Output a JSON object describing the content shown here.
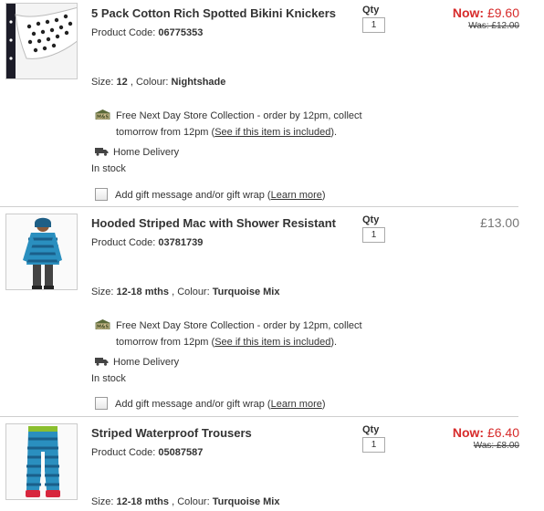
{
  "items": [
    {
      "title": "5 Pack Cotton Rich Spotted Bikini Knickers",
      "code_label": "Product Code:",
      "code": "06775353",
      "qty_label": "Qty",
      "qty": "1",
      "price_now_label": "Now:",
      "price_now": "£9.60",
      "price_was": "Was: £12.00",
      "size_label": "Size:",
      "size": "12",
      "colour_label": ", Colour:",
      "colour": "Nightshade",
      "store_text": "Free Next Day Store Collection - order by 12pm, collect",
      "store_text2": "tomorrow  from 12pm (",
      "store_link": "See if this item is included",
      "store_end": ").",
      "home": "Home Delivery",
      "stock": "In stock",
      "gift_text": "Add gift message and/or gift wrap (",
      "gift_link": "Learn more",
      "gift_end": ")"
    },
    {
      "title": "Hooded Striped Mac with Shower Resistant",
      "code_label": "Product Code:",
      "code": "03781739",
      "qty_label": "Qty",
      "qty": "1",
      "price": "£13.00",
      "size_label": "Size:",
      "size": "12-18 mths",
      "colour_label": " , Colour:",
      "colour": "Turquoise Mix",
      "store_text": "Free Next Day Store Collection - order by 12pm, collect",
      "store_text2": "tomorrow  from 12pm (",
      "store_link": "See if this item is included",
      "store_end": ").",
      "home": "Home Delivery",
      "stock": "In stock",
      "gift_text": "Add gift message and/or gift wrap (",
      "gift_link": "Learn more",
      "gift_end": ")"
    },
    {
      "title": "Striped Waterproof Trousers",
      "code_label": "Product Code:",
      "code": "05087587",
      "qty_label": "Qty",
      "qty": "1",
      "price_now_label": "Now:",
      "price_now": "£6.40",
      "price_was": "Was: £8.00",
      "size_label": "Size:",
      "size": "12-18 mths",
      "colour_label": " , Colour:",
      "colour": "Turquoise Mix"
    }
  ],
  "icons": {
    "store": "ms-store-icon",
    "delivery": "delivery-truck-icon"
  },
  "colors": {
    "price_now": "#d72b2b",
    "divider": "#cfcfcf"
  }
}
